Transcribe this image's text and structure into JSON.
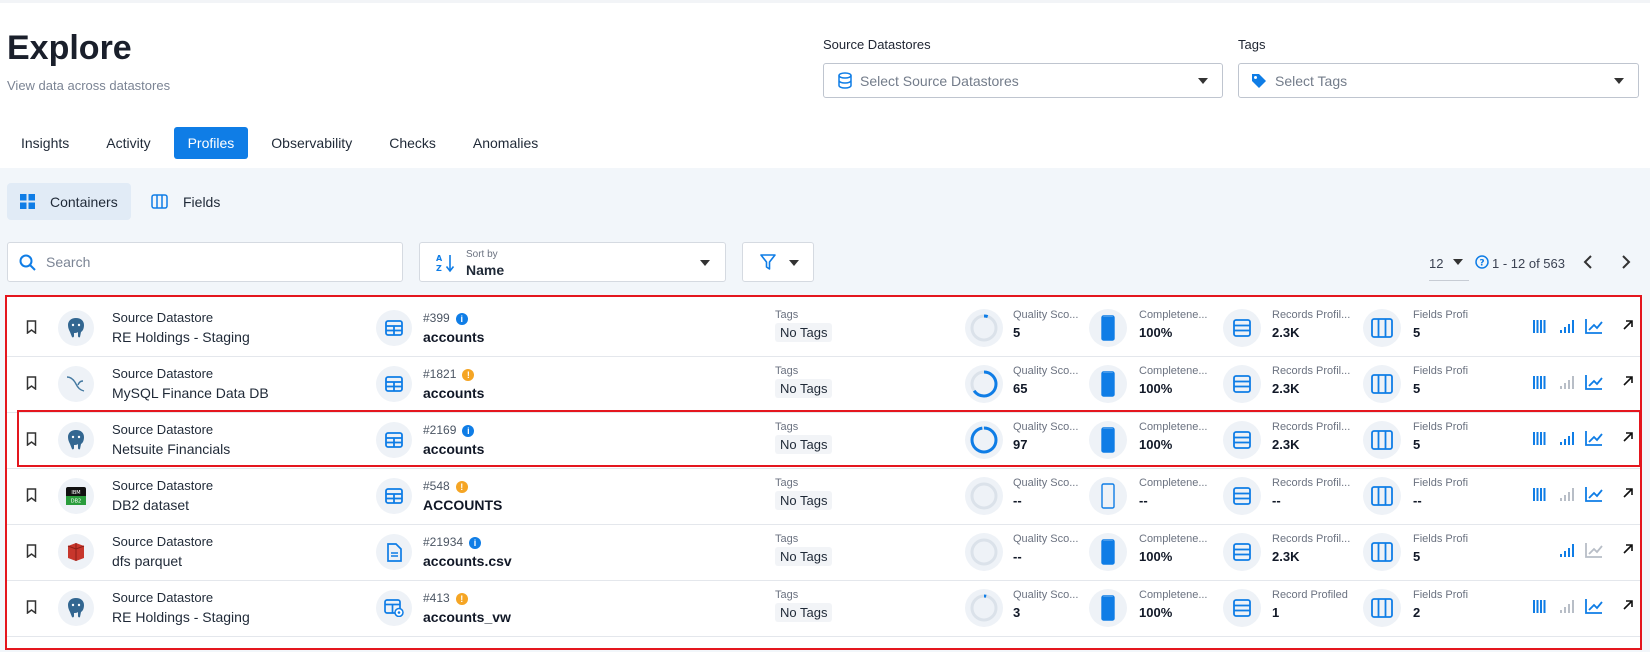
{
  "page": {
    "title": "Explore",
    "subtitle": "View data across datastores"
  },
  "filters": {
    "source_label": "Source Datastores",
    "source_placeholder": "Select Source Datastores",
    "tags_label": "Tags",
    "tags_placeholder": "Select Tags"
  },
  "tabs": [
    {
      "label": "Insights",
      "active": false
    },
    {
      "label": "Activity",
      "active": false
    },
    {
      "label": "Profiles",
      "active": true
    },
    {
      "label": "Observability",
      "active": false
    },
    {
      "label": "Checks",
      "active": false
    },
    {
      "label": "Anomalies",
      "active": false
    }
  ],
  "subtabs": {
    "containers": "Containers",
    "fields": "Fields"
  },
  "toolbar": {
    "search_placeholder": "Search",
    "sort_small": "Sort by",
    "sort_value": "Name",
    "page_size": "12",
    "range": "1 - 12 of 563"
  },
  "colors": {
    "accent": "#0f7de6",
    "highlight": "#e4161e",
    "info_blue": "#0f7de6",
    "info_yellow": "#f5a524"
  },
  "row_labels": {
    "source": "Source Datastore",
    "tags": "Tags",
    "no_tags": "No Tags",
    "quality": "Quality Sco...",
    "completeness": "Completene...",
    "records": "Records Profil...",
    "fields": "Fields Profi"
  },
  "rows": [
    {
      "datastore": "RE Holdings - Staging",
      "icon": "postgres-icon",
      "container_icon": "table-icon",
      "number": "#399",
      "info": "blue",
      "name": "accounts",
      "quality": "5",
      "quality_fraction": 0.05,
      "completeness": "100%",
      "completeness_fraction": 1,
      "records_label": "Records Profil...",
      "records": "2.3K",
      "fields": "5",
      "highlighted": false
    },
    {
      "datastore": "MySQL Finance Data DB",
      "icon": "mysql-icon",
      "container_icon": "table-icon",
      "number": "#1821",
      "info": "yellow",
      "name": "accounts",
      "quality": "65",
      "quality_fraction": 0.65,
      "completeness": "100%",
      "completeness_fraction": 1,
      "records_label": "Records Profil...",
      "records": "2.3K",
      "fields": "5",
      "highlighted": false
    },
    {
      "datastore": "Netsuite Financials",
      "icon": "postgres-icon",
      "container_icon": "table-icon",
      "number": "#2169",
      "info": "blue",
      "name": "accounts",
      "quality": "97",
      "quality_fraction": 0.97,
      "completeness": "100%",
      "completeness_fraction": 1,
      "records_label": "Records Profil...",
      "records": "2.3K",
      "fields": "5",
      "highlighted": true
    },
    {
      "datastore": "DB2 dataset",
      "icon": "db2-icon",
      "container_icon": "table-icon",
      "number": "#548",
      "info": "yellow",
      "name": "ACCOUNTS",
      "quality": "--",
      "quality_fraction": 0,
      "completeness": "--",
      "completeness_fraction": 0,
      "records_label": "Records Profil...",
      "records": "--",
      "fields": "--",
      "highlighted": false
    },
    {
      "datastore": "dfs parquet",
      "icon": "s3-icon",
      "container_icon": "file-icon",
      "number": "#21934",
      "info": "blue",
      "name": "accounts.csv",
      "quality": "--",
      "quality_fraction": 0,
      "completeness": "100%",
      "completeness_fraction": 1,
      "records_label": "Records Profil...",
      "records": "2.3K",
      "fields": "5",
      "highlighted": false
    },
    {
      "datastore": "RE Holdings - Staging",
      "icon": "postgres-icon",
      "container_icon": "view-icon",
      "number": "#413",
      "info": "yellow",
      "name": "accounts_vw",
      "quality": "3",
      "quality_fraction": 0.03,
      "completeness": "100%",
      "completeness_fraction": 1,
      "records_label": "Record Profiled",
      "records": "1",
      "fields": "2",
      "highlighted": false
    }
  ]
}
